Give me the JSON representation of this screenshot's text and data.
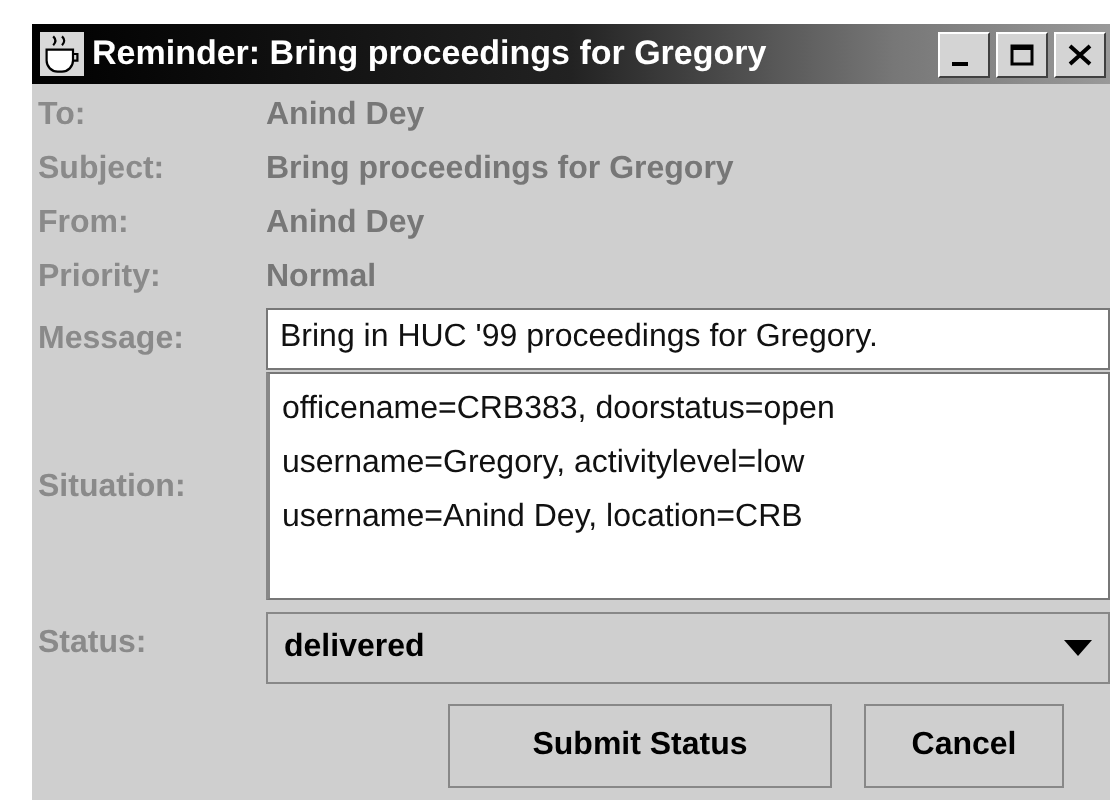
{
  "window": {
    "title": "Reminder: Bring proceedings for Gregory"
  },
  "fields": [
    {
      "label": "To:",
      "value": "Anind Dey"
    },
    {
      "label": "Subject:",
      "value": "Bring proceedings for Gregory"
    },
    {
      "label": "From:",
      "value": "Anind Dey"
    },
    {
      "label": "Priority:",
      "value": "Normal"
    }
  ],
  "message": {
    "label": "Message:",
    "value": "Bring in HUC '99 proceedings for Gregory."
  },
  "situation": {
    "label": "Situation:",
    "lines": [
      "officename=CRB383, doorstatus=open",
      "username=Gregory, activitylevel=low",
      "username=Anind Dey, location=CRB"
    ]
  },
  "status": {
    "label": "Status:",
    "value": "delivered"
  },
  "buttons": [
    "Submit Status",
    "Cancel"
  ]
}
